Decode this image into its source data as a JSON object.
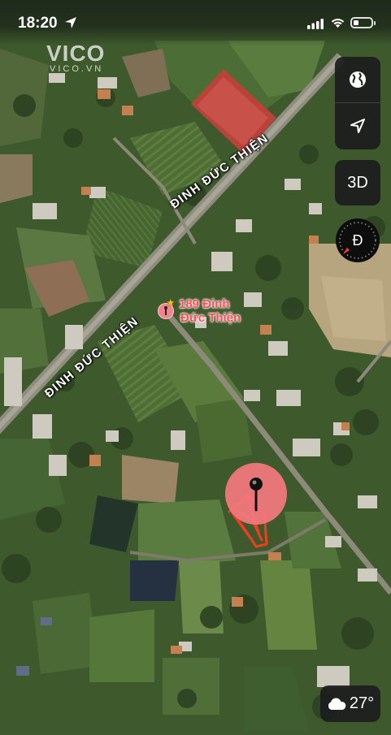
{
  "status_bar": {
    "time": "18:20",
    "location_icon": "location-arrow-icon",
    "signal_icon": "cellular-signal-icon",
    "wifi_icon": "wifi-icon",
    "battery_icon": "battery-low-icon"
  },
  "watermark": {
    "logo": "VICO",
    "site": "VICO.VN"
  },
  "map": {
    "type": "satellite",
    "road_labels": [
      "ĐINH ĐỨC THIỆN",
      "ĐINH ĐỨC THIỆN"
    ],
    "poi": {
      "line1": "189 Đinh",
      "line2": "Đức Thiện",
      "color": "#ff4d55",
      "icon": "star-icon"
    },
    "dropped_pin": {
      "icon": "map-pin-icon",
      "color": "#f5787f"
    }
  },
  "controls": {
    "map_style_icon": "globe-icon",
    "locate_icon": "navigation-arrow-icon",
    "view_3d_label": "3D",
    "compass_label": "Đ"
  },
  "weather": {
    "icon": "cloud-icon",
    "temperature": "27°"
  }
}
